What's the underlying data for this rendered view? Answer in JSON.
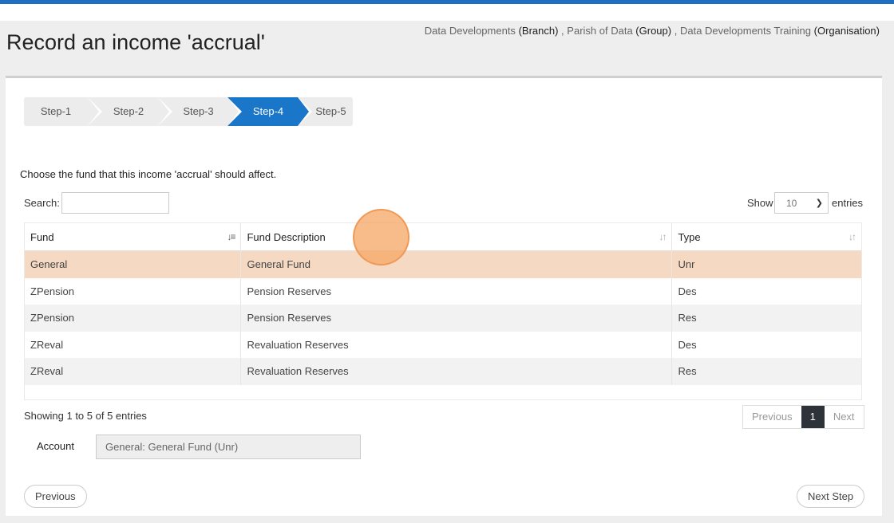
{
  "page": {
    "title": "Record an income 'accrual'",
    "breadcrumb": [
      {
        "name": "Data Developments",
        "kind": "(Branch)"
      },
      {
        "name": "Parish of Data",
        "kind": "(Group)"
      },
      {
        "name": "Data Developments Training",
        "kind": "(Organisation)"
      }
    ],
    "breadcrumb_sep": ","
  },
  "stepper": {
    "steps": [
      "Step-1",
      "Step-2",
      "Step-3",
      "Step-4",
      "Step-5"
    ],
    "active_step": "Step-4"
  },
  "instruction": "Choose the fund that this income 'accrual' should affect.",
  "table_controls": {
    "search_label": "Search:",
    "search_value": "",
    "show_label": "Show",
    "show_value": "10",
    "entries_label": "entries"
  },
  "table": {
    "columns": [
      "Fund",
      "Fund Description",
      "Type"
    ],
    "rows": [
      [
        "General",
        "General Fund",
        "Unr"
      ],
      [
        "ZPension",
        "Pension Reserves",
        "Des"
      ],
      [
        "ZPension",
        "Pension Reserves",
        "Res"
      ],
      [
        "ZReval",
        "Revaluation Reserves",
        "Des"
      ],
      [
        "ZReval",
        "Revaluation Reserves",
        "Res"
      ]
    ],
    "selected_row": 0
  },
  "footer": {
    "showing": "Showing 1 to 5 of 5 entries",
    "pager": {
      "previous": "Previous",
      "current": "1",
      "next": "Next"
    }
  },
  "account": {
    "label": "Account",
    "value": "General: General Fund (Unr)"
  },
  "nav": {
    "previous_label": "Previous",
    "next_label": "Next Step"
  },
  "colors": {
    "accent": "#1a76c9",
    "selected_row": "#f5d9c3",
    "click_marker": "#f5a564"
  }
}
